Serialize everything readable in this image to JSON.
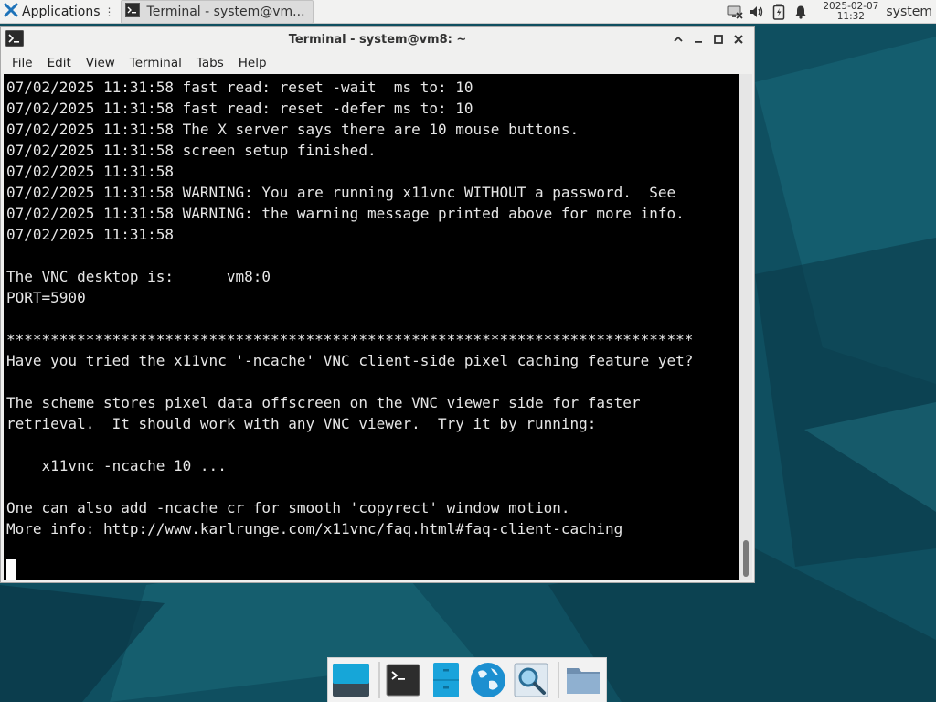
{
  "panel": {
    "applications_label": "Applications",
    "applications_sep": "⋮",
    "task_label": "Terminal - system@vm...",
    "clock_date": "2025-02-07",
    "clock_time": "11:32",
    "user": "system"
  },
  "window": {
    "title": "Terminal - system@vm8: ~",
    "menu": [
      "File",
      "Edit",
      "View",
      "Terminal",
      "Tabs",
      "Help"
    ]
  },
  "terminal_lines": [
    "07/02/2025 11:31:58 fast read: reset -wait  ms to: 10",
    "07/02/2025 11:31:58 fast read: reset -defer ms to: 10",
    "07/02/2025 11:31:58 The X server says there are 10 mouse buttons.",
    "07/02/2025 11:31:58 screen setup finished.",
    "07/02/2025 11:31:58",
    "07/02/2025 11:31:58 WARNING: You are running x11vnc WITHOUT a password.  See",
    "07/02/2025 11:31:58 WARNING: the warning message printed above for more info.",
    "07/02/2025 11:31:58",
    "",
    "The VNC desktop is:      vm8:0",
    "PORT=5900",
    "",
    "******************************************************************************",
    "Have you tried the x11vnc '-ncache' VNC client-side pixel caching feature yet?",
    "",
    "The scheme stores pixel data offscreen on the VNC viewer side for faster",
    "retrieval.  It should work with any VNC viewer.  Try it by running:",
    "",
    "    x11vnc -ncache 10 ...",
    "",
    "One can also add -ncache_cr for smooth 'copyrect' window motion.",
    "More info: http://www.karlrunge.com/x11vnc/faq.html#faq-client-caching"
  ],
  "dock": {
    "items": [
      "show-desktop-icon",
      "terminal-icon",
      "file-cabinet-icon",
      "web-browser-icon",
      "app-finder-icon",
      "home-folder-icon"
    ]
  },
  "colors": {
    "desktop": "#0e4d5f",
    "terminal_bg": "#000000",
    "terminal_fg": "#e6e6e6",
    "panel": "#f2f2f1"
  }
}
